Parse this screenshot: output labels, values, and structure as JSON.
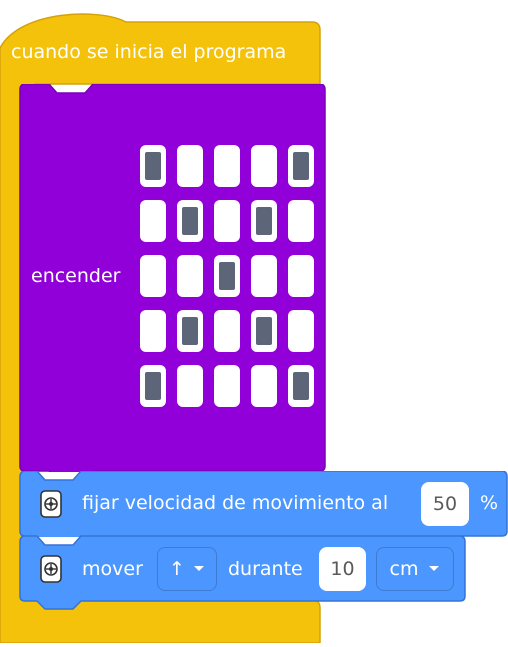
{
  "program": {
    "hat_label": "cuando se inicia el programa"
  },
  "light_block": {
    "label": "encender",
    "grid": [
      [
        1,
        0,
        0,
        0,
        1
      ],
      [
        0,
        1,
        0,
        1,
        0
      ],
      [
        0,
        0,
        1,
        0,
        0
      ],
      [
        0,
        1,
        0,
        1,
        0
      ],
      [
        1,
        0,
        0,
        0,
        1
      ]
    ]
  },
  "speed_block": {
    "label": "fijar velocidad de movimiento al",
    "value": "50",
    "unit": "%"
  },
  "move_block": {
    "label": "mover",
    "direction": "↑",
    "during_label": "durante",
    "amount": "10",
    "unit": "cm"
  },
  "colors": {
    "events": "#f5c20b",
    "events_dark": "#d3a20b",
    "light": "#9100d8",
    "light_dark": "#7a00b8",
    "motion": "#4c97ff",
    "motion_dark": "#3473d6",
    "led_on": "#5d6679"
  },
  "icons": [
    "robot-icon",
    "dropdown-arrow-icon"
  ]
}
